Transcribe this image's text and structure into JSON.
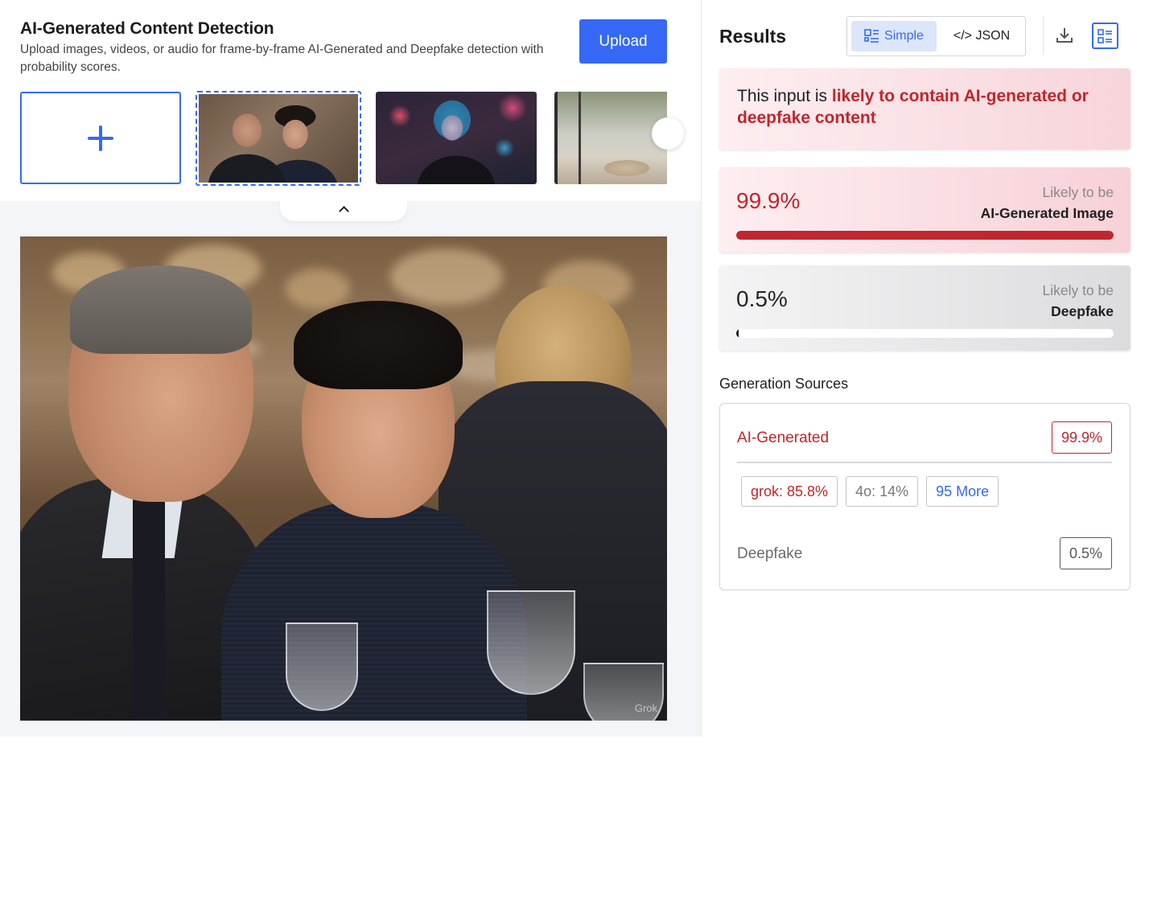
{
  "header": {
    "title": "AI-Generated Content Detection",
    "subtitle": "Upload images, videos, or audio for frame-by-frame AI-Generated and Deepfake detection with probability scores.",
    "upload_label": "Upload"
  },
  "preview": {
    "watermark": "Grok"
  },
  "results": {
    "title": "Results",
    "view_simple": "Simple",
    "view_json": "</> JSON",
    "verdict_prefix": "This input is ",
    "verdict_highlight": "likely to contain AI-generated or deepfake content",
    "ai_card": {
      "percent": "99.9%",
      "likely_prefix": "Likely to be",
      "likely_label": "AI-Generated Image",
      "fill_fraction": 0.999
    },
    "deepfake_card": {
      "percent": "0.5%",
      "likely_prefix": "Likely to be",
      "likely_label": "Deepfake",
      "fill_fraction": 0.005
    },
    "generation_sources": {
      "title": "Generation Sources",
      "ai_label": "AI-Generated",
      "ai_score": "99.9%",
      "chips": [
        "grok: 85.8%",
        "4o: 14%",
        "95 More"
      ],
      "deepfake_label": "Deepfake",
      "deepfake_score": "0.5%"
    }
  },
  "colors": {
    "accent": "#3569f5",
    "danger": "#c0262d"
  },
  "icons": [
    "plus-icon",
    "chevron-right-icon",
    "chevron-up-icon",
    "list-view-icon",
    "download-icon",
    "detail-view-icon"
  ]
}
